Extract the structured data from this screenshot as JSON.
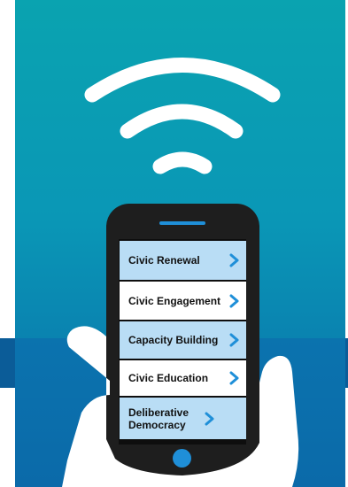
{
  "menu": {
    "items": [
      {
        "label": "Civic Renewal"
      },
      {
        "label": "Civic Engagement"
      },
      {
        "label": "Capacity Building"
      },
      {
        "label": "Civic Education"
      },
      {
        "label": "Deliberative Democracy"
      }
    ]
  },
  "colors": {
    "background_top": "#0aa3b0",
    "background_bottom": "#0b6aa9",
    "band": "#0b5c98",
    "phone_body": "#1e1e1e",
    "accent": "#1f8fd8",
    "item_light": "#b9ddf5",
    "item_white": "#ffffff"
  },
  "icons": [
    "wifi-signal-icon",
    "chevron-right-icon",
    "hand-icon",
    "home-button-icon",
    "speaker-icon"
  ]
}
